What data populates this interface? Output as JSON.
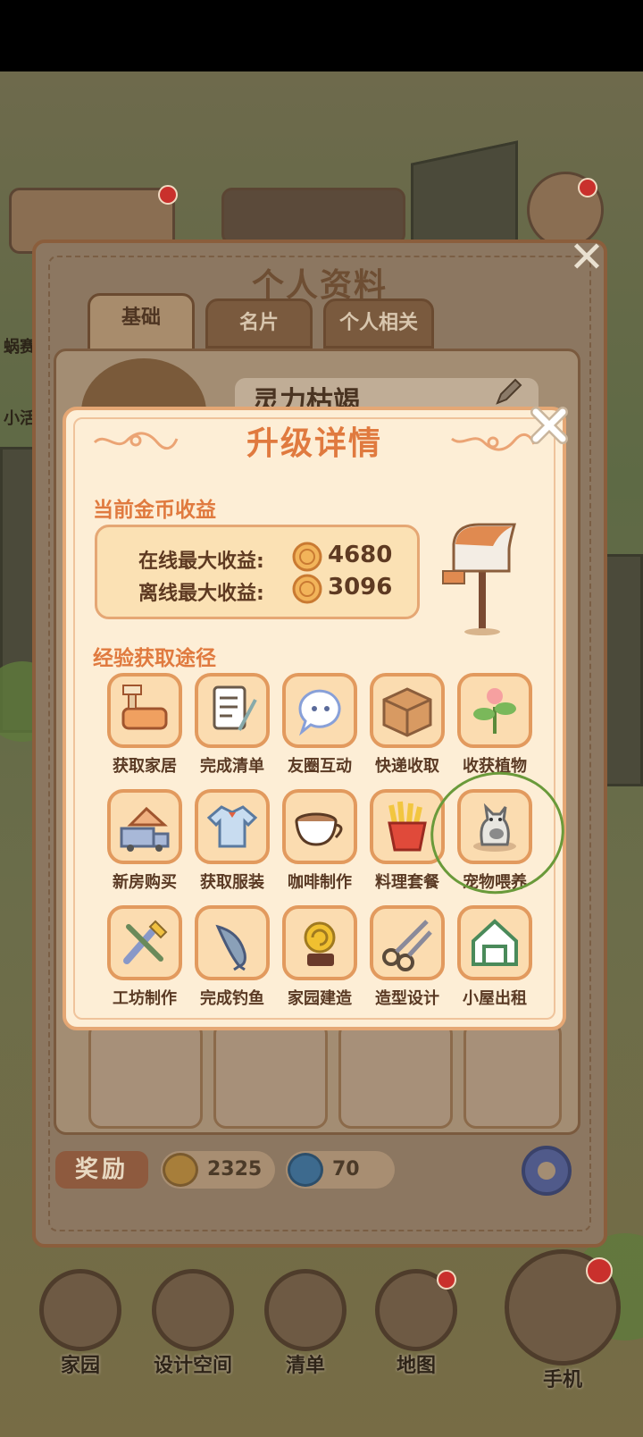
{
  "profile_panel": {
    "title": "个人资料",
    "tabs": [
      "基础",
      "名片",
      "个人相关"
    ],
    "player_name": "灵力枯竭",
    "reward_label": "奖励",
    "reward_coins": "2325",
    "reward_gems": "70"
  },
  "side_hud": {
    "left_labels": [
      "蜗赛",
      "小活"
    ]
  },
  "dialog": {
    "title": "升级详情",
    "coin_section_title": "当前金币收益",
    "online_label": "在线最大收益:",
    "online_value": "4680",
    "offline_label": "离线最大收益:",
    "offline_value": "3096",
    "exp_section_title": "经验获取途径",
    "exp_items": [
      {
        "label": "获取家居",
        "icon": "furniture-icon"
      },
      {
        "label": "完成清单",
        "icon": "checklist-icon"
      },
      {
        "label": "友圈互动",
        "icon": "chat-bubble-icon"
      },
      {
        "label": "快递收取",
        "icon": "parcel-icon"
      },
      {
        "label": "收获植物",
        "icon": "plant-icon"
      },
      {
        "label": "新房购买",
        "icon": "moving-truck-icon"
      },
      {
        "label": "获取服装",
        "icon": "shirt-icon"
      },
      {
        "label": "咖啡制作",
        "icon": "coffee-cup-icon"
      },
      {
        "label": "料理套餐",
        "icon": "fries-icon"
      },
      {
        "label": "宠物喂养",
        "icon": "cat-icon"
      },
      {
        "label": "工坊制作",
        "icon": "tools-icon"
      },
      {
        "label": "完成钓鱼",
        "icon": "fish-icon"
      },
      {
        "label": "家园建造",
        "icon": "snail-icon"
      },
      {
        "label": "造型设计",
        "icon": "scissors-icon"
      },
      {
        "label": "小屋出租",
        "icon": "house-rent-icon"
      }
    ]
  },
  "bottom_nav": [
    "家园",
    "设计空间",
    "清单",
    "地图",
    "手机"
  ],
  "colors": {
    "accent": "#e07a3f",
    "panel": "#fdeed6",
    "border": "#e5a774",
    "tile": "#fbdcb0"
  }
}
